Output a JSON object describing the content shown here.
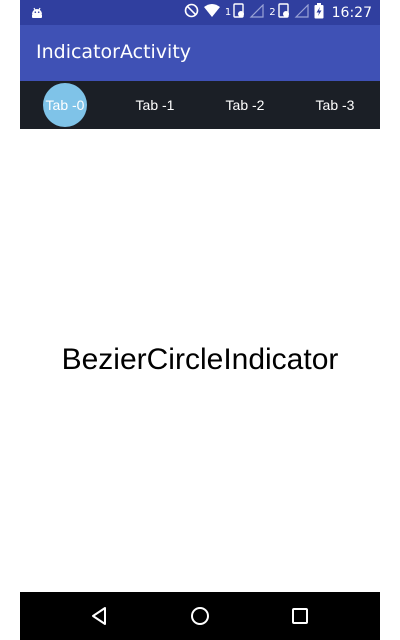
{
  "status_bar": {
    "time": "16:27",
    "sim1_label": "1",
    "sim2_label": "2",
    "icons": [
      "android-icon",
      "do-not-disturb-icon",
      "wifi-icon",
      "sim1-signal-icon",
      "sim2-signal-icon",
      "battery-charging-icon"
    ]
  },
  "app_bar": {
    "title": "IndicatorActivity"
  },
  "tabs": [
    {
      "label": "Tab -0",
      "selected": true
    },
    {
      "label": "Tab -1",
      "selected": false
    },
    {
      "label": "Tab -2",
      "selected": false
    },
    {
      "label": "Tab -3",
      "selected": false
    }
  ],
  "content": {
    "text": "BezierCircleIndicator"
  },
  "nav_bar": {
    "icons": [
      "back-icon",
      "home-icon",
      "recents-icon"
    ]
  },
  "colors": {
    "status_bar": "#303f9f",
    "app_bar": "#3f51b5",
    "tab_strip": "#1b1f26",
    "indicator": "#7fc3e8",
    "nav_bar": "#000000"
  }
}
